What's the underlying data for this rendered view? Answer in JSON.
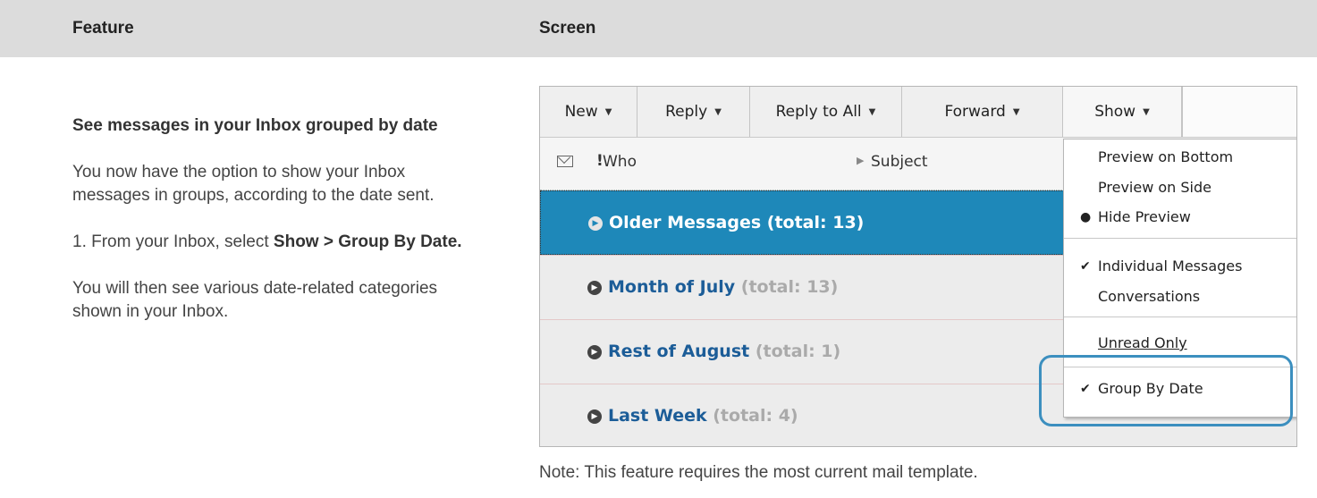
{
  "header": {
    "feature_label": "Feature",
    "screen_label": "Screen"
  },
  "feature": {
    "title": "See messages in your Inbox grouped by date",
    "intro": "You now have the option to show your Inbox messages in groups, according to the date sent.",
    "step_prefix": "1. From your Inbox, select ",
    "step_bold": "Show > Group By Date.",
    "result": "You will then see various date-related categories shown in your Inbox."
  },
  "toolbar": {
    "buttons": [
      "New",
      "Reply",
      "Reply to All",
      "Forward",
      "Show"
    ]
  },
  "list_header": {
    "flag": "!",
    "who": "Who",
    "subject": "Subject"
  },
  "groups": [
    {
      "label": "Older Messages (total: 13)",
      "total": ""
    },
    {
      "label": "Month of July",
      "total": "(total: 13)"
    },
    {
      "label": "Rest of August",
      "total": "(total: 1)"
    },
    {
      "label": "Last Week",
      "total": "(total: 4)"
    }
  ],
  "show_menu": {
    "items": [
      {
        "label": "Preview on Bottom",
        "mark": ""
      },
      {
        "label": "Preview on Side",
        "mark": ""
      },
      {
        "label": "Hide Preview",
        "mark": "●"
      },
      {
        "label": "Individual Messages",
        "mark": "✔"
      },
      {
        "label": "Conversations",
        "mark": ""
      },
      {
        "label": "Unread Only",
        "mark": ""
      },
      {
        "label": "Group By Date",
        "mark": "✔"
      }
    ]
  },
  "note": "Note: This feature requires the most current mail template.",
  "colors": {
    "header_bg": "#dcdcdc",
    "selected_row": "#1e88b9",
    "link_blue": "#1c5d98",
    "highlight": "#3c8fbf"
  }
}
